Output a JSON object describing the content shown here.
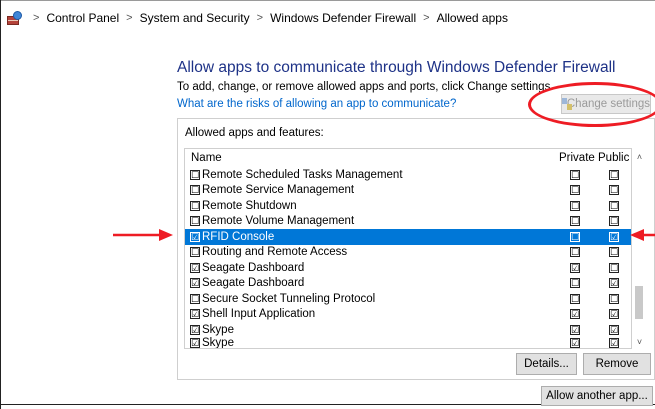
{
  "breadcrumb": {
    "icon": "firewall-icon",
    "items": [
      "Control Panel",
      "System and Security",
      "Windows Defender Firewall",
      "Allowed apps"
    ],
    "separator": ">"
  },
  "header": {
    "title": "Allow apps to communicate through Windows Defender Firewall",
    "subtitle": "To add, change, or remove allowed apps and ports, click Change settings.",
    "risk_link": "What are the risks of allowing an app to communicate?",
    "change_settings_label": "Change settings"
  },
  "panel": {
    "label": "Allowed apps and features:",
    "columns": {
      "name": "Name",
      "private": "Private",
      "public": "Public"
    },
    "rows": [
      {
        "name": "Remote Scheduled Tasks Management",
        "enabled": "☐",
        "private": "☐",
        "public": "☐"
      },
      {
        "name": "Remote Service Management",
        "enabled": "☐",
        "private": "☐",
        "public": "☐"
      },
      {
        "name": "Remote Shutdown",
        "enabled": "☐",
        "private": "☐",
        "public": "☐"
      },
      {
        "name": "Remote Volume Management",
        "enabled": "☐",
        "private": "☐",
        "public": "☐"
      },
      {
        "name": "RFID Console",
        "enabled": "☑",
        "private": "☐",
        "public": "☑",
        "selected": true
      },
      {
        "name": "Routing and Remote Access",
        "enabled": "☐",
        "private": "☐",
        "public": "☐"
      },
      {
        "name": "Seagate Dashboard",
        "enabled": "☑",
        "private": "☑",
        "public": "☐"
      },
      {
        "name": "Seagate Dashboard",
        "enabled": "☑",
        "private": "☐",
        "public": "☑"
      },
      {
        "name": "Secure Socket Tunneling Protocol",
        "enabled": "☐",
        "private": "☐",
        "public": "☐"
      },
      {
        "name": "Shell Input Application",
        "enabled": "☑",
        "private": "☑",
        "public": "☑"
      },
      {
        "name": "Skype",
        "enabled": "☑",
        "private": "☑",
        "public": "☑"
      },
      {
        "name": "Skype",
        "enabled": "☑",
        "private": "☑",
        "public": "☑"
      }
    ],
    "details_label": "Details...",
    "remove_label": "Remove"
  },
  "allow_another_label": "Allow another app...",
  "colors": {
    "title": "#1e3287",
    "link": "#0066cc",
    "selection": "#0077d7",
    "annotation_red": "#ee1c24"
  }
}
